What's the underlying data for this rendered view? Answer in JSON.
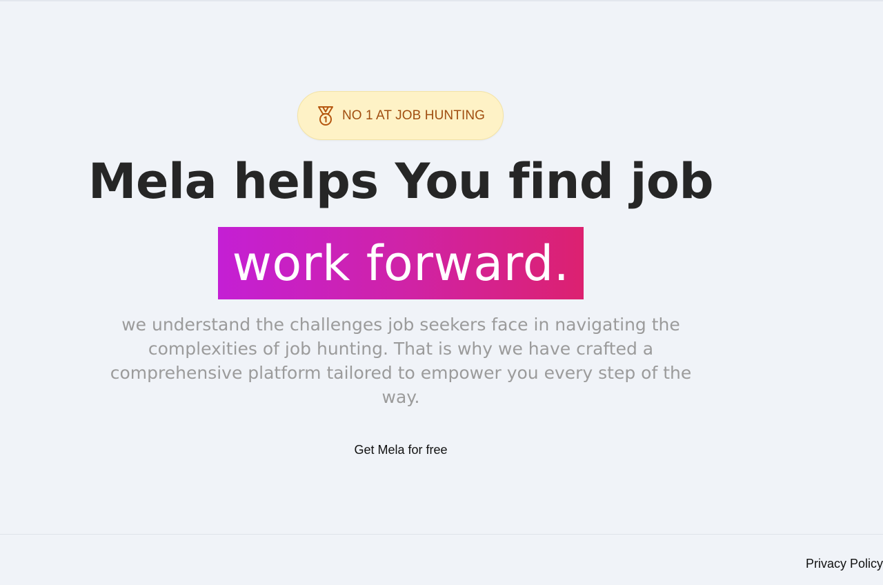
{
  "hero": {
    "badge": {
      "icon": "medal-icon",
      "text": "NO 1 AT JOB HUNTING"
    },
    "headline": "Mela helps You find job",
    "highlight": "work forward.",
    "description": "we understand the challenges job seekers face in navigating the complexities of job hunting. That is why we have crafted a comprehensive platform tailored to empower you every step of the way.",
    "cta_label": "Get Mela for free"
  },
  "footer": {
    "privacy_link": "Privacy Policy"
  },
  "colors": {
    "background": "#f0f3f8",
    "badge_bg": "#fef2c6",
    "badge_text": "#a04e10",
    "highlight_gradient_start": "#c41fd4",
    "highlight_gradient_end": "#dc2170",
    "headline": "#262626",
    "description": "#9b9b9b"
  }
}
